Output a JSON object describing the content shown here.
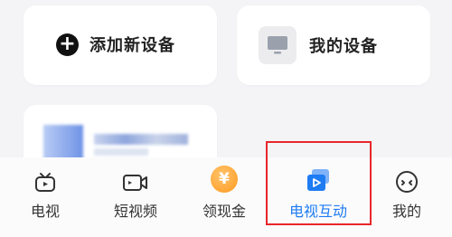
{
  "cards": {
    "add_device": {
      "label": "添加新设备",
      "icon": "plus-circle-icon"
    },
    "my_devices": {
      "label": "我的设备",
      "icon": "tv-icon"
    }
  },
  "tabbar": {
    "items": [
      {
        "label": "电视",
        "icon": "tv-icon"
      },
      {
        "label": "短视频",
        "icon": "video-camera-icon"
      },
      {
        "label": "领现金",
        "icon": "yuan-coin-icon",
        "glyph": "¥"
      },
      {
        "label": "电视互动",
        "icon": "cast-play-icon",
        "active": true
      },
      {
        "label": "我的",
        "icon": "smiley-face-icon"
      }
    ]
  },
  "colors": {
    "accent": "#1e7cf2",
    "highlight": "#e8262b",
    "coin": "#ff9a1f"
  }
}
